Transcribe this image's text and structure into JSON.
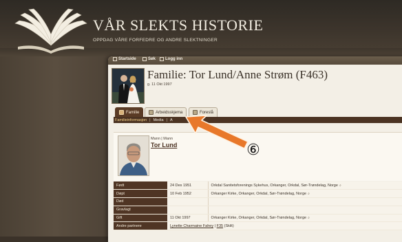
{
  "site": {
    "title": "VÅR SLEKTS HISTORIE",
    "tagline": "OPPDAG VÅRE FORFEDRE OG ANDRE SLEKTNINGER"
  },
  "topnav": [
    {
      "label": "Startside",
      "icon": "home-icon"
    },
    {
      "label": "Søk",
      "icon": "search-icon"
    },
    {
      "label": "Logg inn",
      "icon": "login-icon"
    }
  ],
  "family": {
    "title": "Familie: Tor Lund/Anne Strøm (F463)",
    "date": "g. 11 Okt 1997"
  },
  "tabs": [
    {
      "label": "Familie",
      "icon": "family-icon",
      "active": true
    },
    {
      "label": "Arbeidsskjema",
      "icon": "worksheet-icon",
      "active": false
    },
    {
      "label": "Foreslå",
      "icon": "suggest-icon",
      "active": false
    }
  ],
  "subnav": [
    {
      "label": "Familieinformasjon",
      "active": true
    },
    {
      "label": "Media",
      "active": false
    },
    {
      "label": "A",
      "active": false
    }
  ],
  "person": {
    "role": "Mann | Mann",
    "name": "Tor Lund"
  },
  "events": [
    {
      "label": "Født",
      "date": "24 Des 1951",
      "place": "Orkdal Sanitetsforenings Sykehus, Orkanger, Orkdal, Sør-Trøndelag, Norge",
      "has_place_icon": true
    },
    {
      "label": "Døpt",
      "date": "10 Feb 1952",
      "place": "Orkanger Kirke, Orkanger, Orkdal, Sør-Trøndelag, Norge",
      "has_place_icon": true
    },
    {
      "label": "Død",
      "date": "",
      "place": "",
      "has_place_icon": false
    },
    {
      "label": "Gravlagt",
      "date": "",
      "place": "",
      "has_place_icon": false
    },
    {
      "label": "Gift",
      "date": "11 Okt 1997",
      "place": "Orkanger Kirke, Orkanger, Orkdal, Sør-Trøndelag, Norge",
      "has_place_icon": true
    }
  ],
  "partners": {
    "label": "Andre partnere",
    "name": "Lynette Charmaine Fahey",
    "family_ref": "F35",
    "status": "(Skilt)"
  },
  "annotation": {
    "marker": "⑥",
    "arrow_color": "#e8782a"
  },
  "place_glyph": "⌕",
  "nav_sep": "|"
}
